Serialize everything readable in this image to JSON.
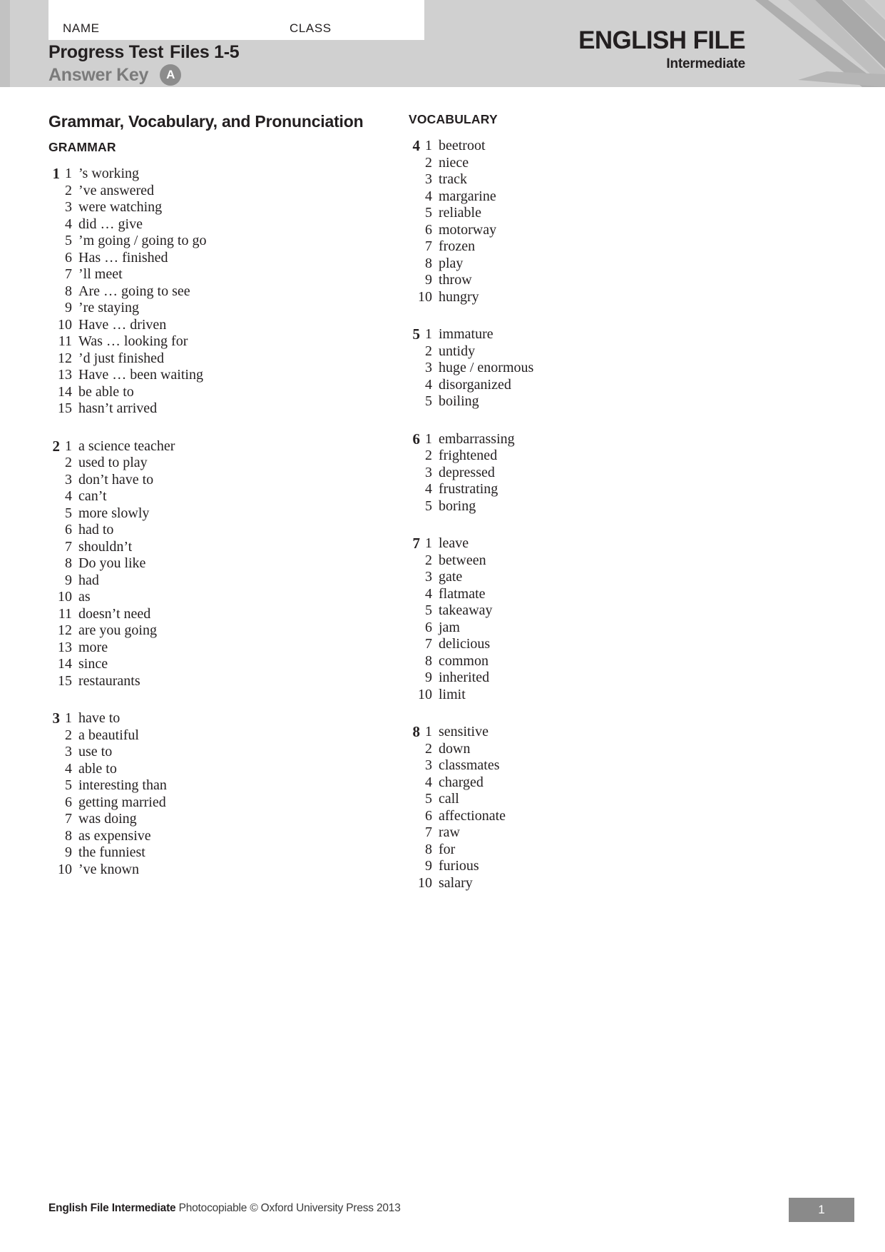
{
  "header": {
    "name_label": "NAME",
    "class_label": "CLASS",
    "title_main": "Progress Test",
    "title_files": "Files 1-5",
    "title_sub": "Answer Key",
    "version_badge": "A",
    "brand_main": "ENGLISH FILE",
    "brand_sub": "Intermediate"
  },
  "section_title": "Grammar, Vocabulary, and Pronunciation",
  "columns": {
    "left": {
      "heading": "GRAMMAR",
      "exercises": [
        {
          "number": "1",
          "items": [
            {
              "n": "1",
              "text": "’s working"
            },
            {
              "n": "2",
              "text": "’ve answered"
            },
            {
              "n": "3",
              "text": "were watching"
            },
            {
              "n": "4",
              "text": "did … give"
            },
            {
              "n": "5",
              "text": "’m going / going to go"
            },
            {
              "n": "6",
              "text": "Has … finished"
            },
            {
              "n": "7",
              "text": "’ll meet"
            },
            {
              "n": "8",
              "text": "Are … going to see"
            },
            {
              "n": "9",
              "text": "’re staying"
            },
            {
              "n": "10",
              "text": "Have … driven"
            },
            {
              "n": "11",
              "text": "Was … looking for"
            },
            {
              "n": "12",
              "text": "’d just finished"
            },
            {
              "n": "13",
              "text": "Have … been waiting"
            },
            {
              "n": "14",
              "text": "be able to"
            },
            {
              "n": "15",
              "text": "hasn’t arrived"
            }
          ]
        },
        {
          "number": "2",
          "items": [
            {
              "n": "1",
              "text": "a science teacher"
            },
            {
              "n": "2",
              "text": "used to play"
            },
            {
              "n": "3",
              "text": "don’t have to"
            },
            {
              "n": "4",
              "text": "can’t"
            },
            {
              "n": "5",
              "text": "more slowly"
            },
            {
              "n": "6",
              "text": "had to"
            },
            {
              "n": "7",
              "text": "shouldn’t"
            },
            {
              "n": "8",
              "text": "Do you like"
            },
            {
              "n": "9",
              "text": "had"
            },
            {
              "n": "10",
              "text": "as"
            },
            {
              "n": "11",
              "text": "doesn’t need"
            },
            {
              "n": "12",
              "text": "are you going"
            },
            {
              "n": "13",
              "text": "more"
            },
            {
              "n": "14",
              "text": "since"
            },
            {
              "n": "15",
              "text": "restaurants"
            }
          ]
        },
        {
          "number": "3",
          "items": [
            {
              "n": "1",
              "text": "have to"
            },
            {
              "n": "2",
              "text": "a beautiful"
            },
            {
              "n": "3",
              "text": "use to"
            },
            {
              "n": "4",
              "text": "able to"
            },
            {
              "n": "5",
              "text": "interesting than"
            },
            {
              "n": "6",
              "text": "getting married"
            },
            {
              "n": "7",
              "text": "was doing"
            },
            {
              "n": "8",
              "text": "as expensive"
            },
            {
              "n": "9",
              "text": "the funniest"
            },
            {
              "n": "10",
              "text": "’ve known"
            }
          ]
        }
      ]
    },
    "right": {
      "heading": "VOCABULARY",
      "exercises": [
        {
          "number": "4",
          "items": [
            {
              "n": "1",
              "text": "beetroot"
            },
            {
              "n": "2",
              "text": "niece"
            },
            {
              "n": "3",
              "text": "track"
            },
            {
              "n": "4",
              "text": "margarine"
            },
            {
              "n": "5",
              "text": "reliable"
            },
            {
              "n": "6",
              "text": "motorway"
            },
            {
              "n": "7",
              "text": "frozen"
            },
            {
              "n": "8",
              "text": "play"
            },
            {
              "n": "9",
              "text": "throw"
            },
            {
              "n": "10",
              "text": "hungry"
            }
          ]
        },
        {
          "number": "5",
          "items": [
            {
              "n": "1",
              "text": "immature"
            },
            {
              "n": "2",
              "text": "untidy"
            },
            {
              "n": "3",
              "text": "huge / enormous"
            },
            {
              "n": "4",
              "text": "disorganized"
            },
            {
              "n": "5",
              "text": "boiling"
            }
          ]
        },
        {
          "number": "6",
          "items": [
            {
              "n": "1",
              "text": "embarrassing"
            },
            {
              "n": "2",
              "text": "frightened"
            },
            {
              "n": "3",
              "text": "depressed"
            },
            {
              "n": "4",
              "text": "frustrating"
            },
            {
              "n": "5",
              "text": "boring"
            }
          ]
        },
        {
          "number": "7",
          "items": [
            {
              "n": "1",
              "text": "leave"
            },
            {
              "n": "2",
              "text": "between"
            },
            {
              "n": "3",
              "text": "gate"
            },
            {
              "n": "4",
              "text": "flatmate"
            },
            {
              "n": "5",
              "text": "takeaway"
            },
            {
              "n": "6",
              "text": "jam"
            },
            {
              "n": "7",
              "text": "delicious"
            },
            {
              "n": "8",
              "text": "common"
            },
            {
              "n": "9",
              "text": "inherited"
            },
            {
              "n": "10",
              "text": "limit"
            }
          ]
        },
        {
          "number": "8",
          "items": [
            {
              "n": "1",
              "text": "sensitive"
            },
            {
              "n": "2",
              "text": "down"
            },
            {
              "n": "3",
              "text": "classmates"
            },
            {
              "n": "4",
              "text": "charged"
            },
            {
              "n": "5",
              "text": "call"
            },
            {
              "n": "6",
              "text": "affectionate"
            },
            {
              "n": "7",
              "text": "raw"
            },
            {
              "n": "8",
              "text": "for"
            },
            {
              "n": "9",
              "text": "furious"
            },
            {
              "n": "10",
              "text": "salary"
            }
          ]
        }
      ]
    }
  },
  "footer": {
    "bold": "English File Intermediate",
    "normal": "Photocopiable © Oxford University Press 2013",
    "page_number": "1"
  }
}
